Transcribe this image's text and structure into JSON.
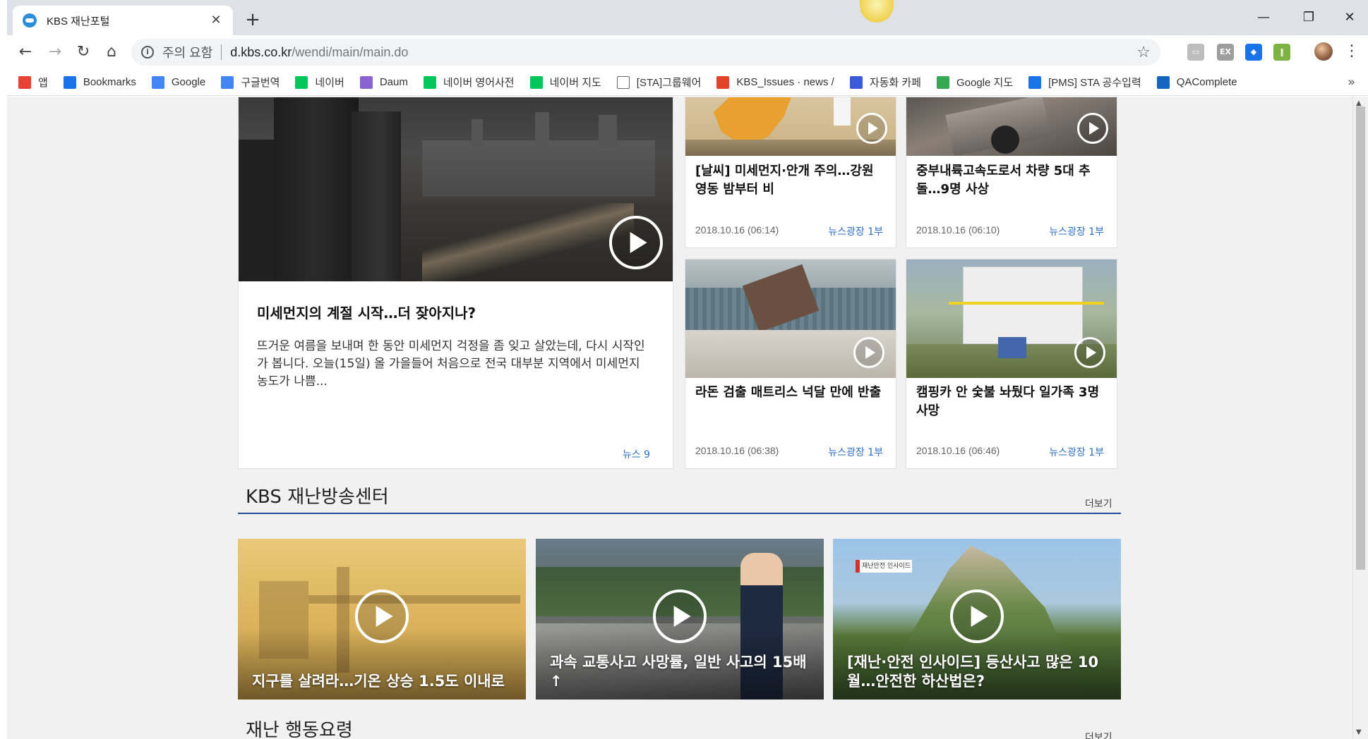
{
  "browser": {
    "tab_title": "KBS 재난포털",
    "tab_close": "✕",
    "new_tab": "+",
    "minimize": "—",
    "restore": "❐",
    "close": "✕",
    "nav_back": "←",
    "nav_forward": "→",
    "nav_reload": "↻",
    "nav_home": "⌂",
    "security_label": "주의 요함",
    "url_host": "d.kbs.co.kr",
    "url_path": "/wendi/main/main.do",
    "bookmark_star": "☆",
    "extensions": [
      {
        "name": "cast-extension",
        "label": "▭",
        "color": "#bdbdbd"
      },
      {
        "name": "ex-extension",
        "label": "EX",
        "color": "#9e9e9e"
      },
      {
        "name": "blue-arrow-extension",
        "label": "◆",
        "color": "#1a73e8"
      },
      {
        "name": "ladder-extension",
        "label": "‖",
        "color": "#7cb342"
      }
    ],
    "menu": "⋮"
  },
  "bookmarks": [
    {
      "label": "앱",
      "icon": "apps-grid-icon",
      "color": "#e94235"
    },
    {
      "label": "Bookmarks",
      "icon": "star-icon",
      "color": "#1a73e8"
    },
    {
      "label": "Google",
      "icon": "google-icon",
      "color": "#4285f4"
    },
    {
      "label": "구글번역",
      "icon": "translate-icon",
      "color": "#4285f4"
    },
    {
      "label": "네이버",
      "icon": "naver-icon",
      "color": "#03c75a"
    },
    {
      "label": "Daum",
      "icon": "daum-icon",
      "color": "#8a63d2"
    },
    {
      "label": "네이버 영어사전",
      "icon": "naver-dict-icon",
      "color": "#03c75a"
    },
    {
      "label": "네이버 지도",
      "icon": "naver-map-icon",
      "color": "#03c75a"
    },
    {
      "label": "[STA]그룹웨어",
      "icon": "page-icon",
      "color": "#ffffff"
    },
    {
      "label": "KBS_Issues · news /",
      "icon": "gitlab-icon",
      "color": "#e24329"
    },
    {
      "label": "자동화 카페",
      "icon": "stay-icon",
      "color": "#3b5bdb"
    },
    {
      "label": "Google 지도",
      "icon": "maps-icon",
      "color": "#34a853"
    },
    {
      "label": "[PMS] STA 공수입력",
      "icon": "pms-icon",
      "color": "#1a73e8"
    },
    {
      "label": "QAComplete",
      "icon": "qacomplete-icon",
      "color": "#1565c0"
    }
  ],
  "bookmarks_more": "»",
  "featured": {
    "title": "미세먼지의 계절 시작…더 잦아지나?",
    "desc": "뜨거운 여름을 보내며 한 동안 미세먼지 걱정을 좀 잊고 살았는데, 다시 시작인가 봅니다. 오늘(15일) 올 가을들어 처음으로 전국 대부분 지역에서 미세먼지 농도가 나쁨...",
    "source": "뉴스 9"
  },
  "cards": [
    {
      "title": "[날씨] 미세먼지·안개 주의…강원 영동 밤부터 비",
      "date": "2018.10.16 (06:14)",
      "source": "뉴스광장 1부"
    },
    {
      "title": "중부내륙고속도로서 차량 5대 추돌…9명 사상",
      "date": "2018.10.16 (06:10)",
      "source": "뉴스광장 1부"
    },
    {
      "title": "라돈 검출 매트리스 넉달 만에 반출",
      "date": "2018.10.16 (06:38)",
      "source": "뉴스광장 1부"
    },
    {
      "title": "캠핑카 안 숯불 놔뒀다 일가족 3명 사망",
      "date": "2018.10.16 (06:46)",
      "source": "뉴스광장 1부"
    }
  ],
  "section_center": {
    "title": "KBS 재난방송센터",
    "more": "더보기",
    "videos": [
      {
        "caption": "지구를 살려라…기온 상승 1.5도 이내로"
      },
      {
        "caption": "과속 교통사고 사망률, 일반 사고의 15배↑"
      },
      {
        "caption": "[재난·안전 인사이드] 등산사고 많은 10월…안전한 하산법은?",
        "badge": "재난안전 인사이드"
      }
    ]
  },
  "section_action": {
    "title": "재난 행동요령",
    "more": "더보기"
  }
}
